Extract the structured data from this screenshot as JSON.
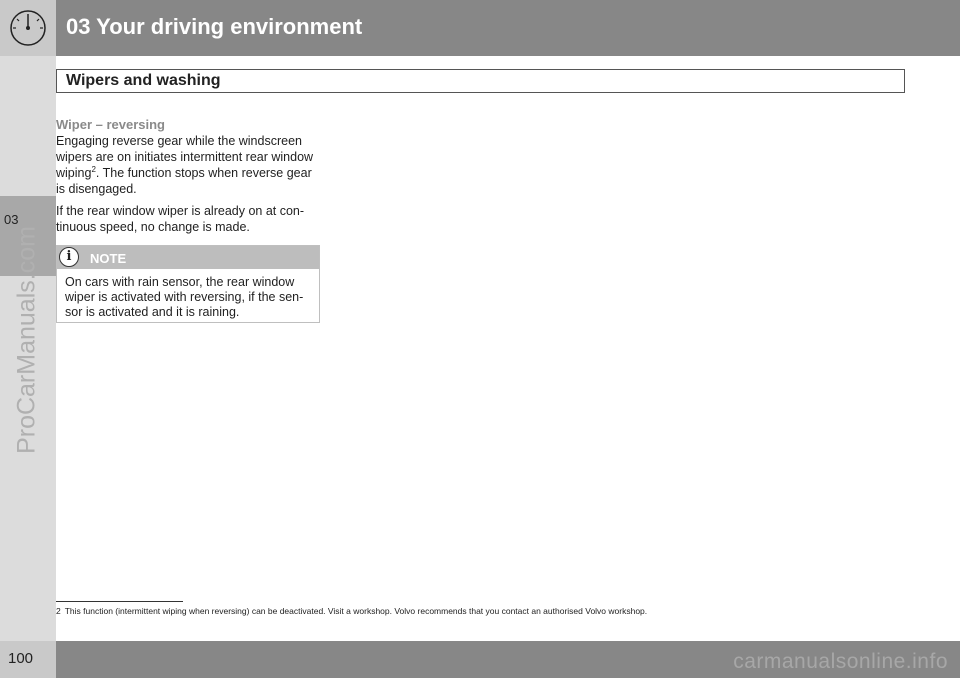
{
  "header": {
    "chapter_title": "03 Your driving environment",
    "icon": "speedometer-icon"
  },
  "sidebar": {
    "chapter_number": "03",
    "watermark": "ProCarManuals.com"
  },
  "section": {
    "title": "Wipers and washing"
  },
  "content": {
    "subheading": "Wiper – reversing",
    "para1_before": "Engaging reverse gear while the windscreen wipers are on initiates intermittent rear window wiping",
    "para1_sup": "2",
    "para1_after": ". The function stops when reverse gear is disengaged.",
    "para2": "If the rear window wiper is already on at con-tinuous speed, no change is made."
  },
  "note": {
    "label": "NOTE",
    "icon": "info-icon",
    "text": "On cars with rain sensor, the rear window wiper is activated with reversing, if the sen-sor is activated and it is raining."
  },
  "footnote": {
    "number": "2",
    "text": "This function (intermittent wiping when reversing) can be deactivated. Visit a workshop. Volvo recommends that you contact an authorised Volvo workshop."
  },
  "footer": {
    "page_number": "100",
    "watermark": "carmanualsonline.info"
  }
}
